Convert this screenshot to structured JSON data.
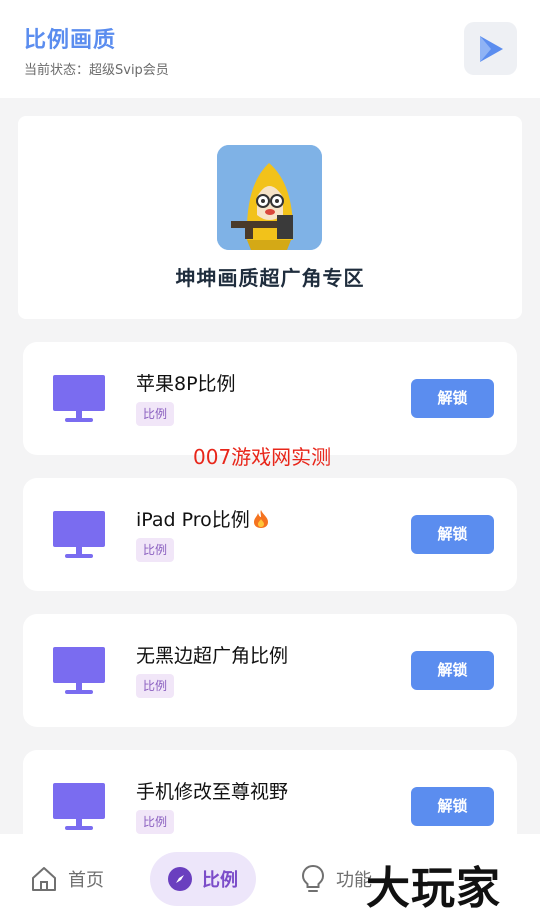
{
  "header": {
    "title": "比例画质",
    "status": "当前状态：超级Svip会员"
  },
  "hero": {
    "title": "坤坤画质超广角专区"
  },
  "cards": [
    {
      "name": "苹果8P比例",
      "tag": "比例",
      "button": "解锁",
      "badge": ""
    },
    {
      "name": "iPad Pro比例",
      "tag": "比例",
      "button": "解锁",
      "badge": "fire-icon"
    },
    {
      "name": "无黑边超广角比例",
      "tag": "比例",
      "button": "解锁",
      "badge": ""
    },
    {
      "name": "手机修改至尊视野",
      "tag": "比例",
      "button": "解锁",
      "badge": ""
    }
  ],
  "watermark": "007游戏网实测",
  "nav": [
    {
      "label": "首页",
      "icon": "home-icon",
      "active": false
    },
    {
      "label": "比例",
      "icon": "compass-icon",
      "active": true
    },
    {
      "label": "功能",
      "icon": "lightbulb-icon",
      "active": false
    }
  ],
  "logo_text": "大玩家",
  "colors": {
    "accent": "#5b8def",
    "monitor": "#7a6cf0",
    "tag_text": "#8a5fc0",
    "tag_bg": "#f1e6f8",
    "nav_active": "#7b4cc9",
    "watermark": "#e8261a"
  }
}
